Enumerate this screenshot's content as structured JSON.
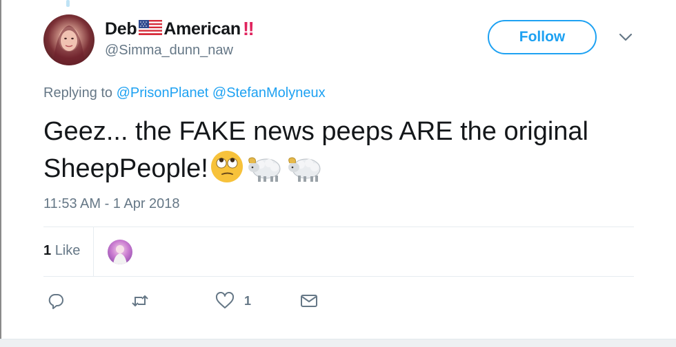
{
  "author": {
    "display_name_part1": "Deb",
    "display_name_part2": "American",
    "flag_icon": "us-flag-icon",
    "exclamation": "‼",
    "handle": "@Simma_dunn_naw"
  },
  "follow_button": {
    "label": "Follow"
  },
  "reply": {
    "prefix": "Replying to",
    "mentions": [
      "@PrisonPlanet",
      "@StefanMolyneux"
    ]
  },
  "tweet": {
    "text": "Geez... the FAKE news peeps ARE the original SheepPeople!",
    "emojis": [
      "face-with-rolling-eyes",
      "ram",
      "ram"
    ],
    "timestamp": "11:53 AM - 1 Apr 2018"
  },
  "stats": {
    "likes_count": "1",
    "likes_label": "Like"
  },
  "actions": {
    "reply_icon": "reply-icon",
    "retweet_icon": "retweet-icon",
    "like_icon": "heart-icon",
    "like_count": "1",
    "dm_icon": "envelope-icon"
  },
  "colors": {
    "accent": "#1da1f2",
    "secondary_text": "#657786",
    "primary_text": "#14171a",
    "alert_red": "#e0245e"
  }
}
